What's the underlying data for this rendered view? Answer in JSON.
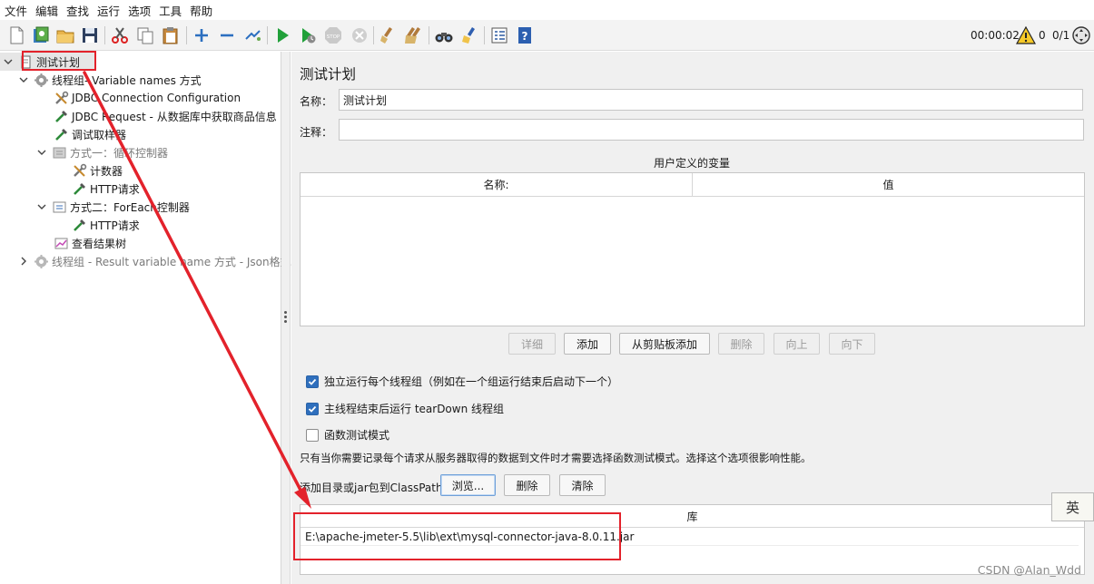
{
  "menu": [
    "文件",
    "编辑",
    "查找",
    "运行",
    "选项",
    "工具",
    "帮助"
  ],
  "toolbar": {
    "icons": [
      "new-icon",
      "templates-icon",
      "open-icon",
      "save-icon",
      "cut-icon",
      "copy-icon",
      "paste-icon",
      "expand-icon",
      "collapse-icon",
      "toggle-icon",
      "start-icon",
      "start-no-pauses-icon",
      "stop-icon",
      "shutdown-icon",
      "clear-icon",
      "clear-all-icon",
      "search-icon",
      "reset-search-icon",
      "function-helper-icon",
      "help-icon"
    ],
    "elapsed": "00:00:02",
    "warnings": "0",
    "threads": "0/1"
  },
  "tree": {
    "root": "测试计划",
    "thread_group_1": {
      "prefix": "线程组",
      "suffix": " - Variable names 方式"
    },
    "jdbc_config": "JDBC Connection Configuration",
    "jdbc_request": "JDBC Request - 从数据库中获取商品信息",
    "debug_sampler": "调试取样器",
    "loop_controller": "方式一：循环控制器",
    "counter": "计数器",
    "http_1": "HTTP请求",
    "foreach_controller": "方式二：ForEach控制器",
    "http_2": "HTTP请求",
    "results_tree": "查看结果树",
    "thread_group_2": "线程组 - Result variable name 方式 - Json格式"
  },
  "panel": {
    "title": "测试计划",
    "name_label": "名称：",
    "name_value": "测试计划",
    "comment_label": "注释：",
    "comment_value": "",
    "vars_title": "用户定义的变量",
    "vars_columns": [
      "名称:",
      "值"
    ],
    "buttons": {
      "detail": "详细",
      "add": "添加",
      "add_clipboard": "从剪贴板添加",
      "delete": "删除",
      "up": "向上",
      "down": "向下"
    },
    "checks": [
      {
        "label": "独立运行每个线程组（例如在一个组运行结束后启动下一个）",
        "checked": true
      },
      {
        "label": "主线程结束后运行 tearDown 线程组",
        "checked": true
      },
      {
        "label": "函数测试模式",
        "checked": false
      }
    ],
    "functional_note": "只有当你需要记录每个请求从服务器取得的数据到文件时才需要选择函数测试模式。选择这个选项很影响性能。",
    "classpath_label": "添加目录或jar包到ClassPath",
    "browse": "浏览...",
    "cp_delete": "删除",
    "cp_clear": "清除",
    "lib_header": "库",
    "lib_rows": [
      "E:\\apache-jmeter-5.5\\lib\\ext\\mysql-connector-java-8.0.11.jar"
    ]
  },
  "ime": "英",
  "watermark": "CSDN @Alan_Wdd",
  "colors": {
    "annotation": "#e3222b",
    "checkbox": "#2f6fbd"
  }
}
